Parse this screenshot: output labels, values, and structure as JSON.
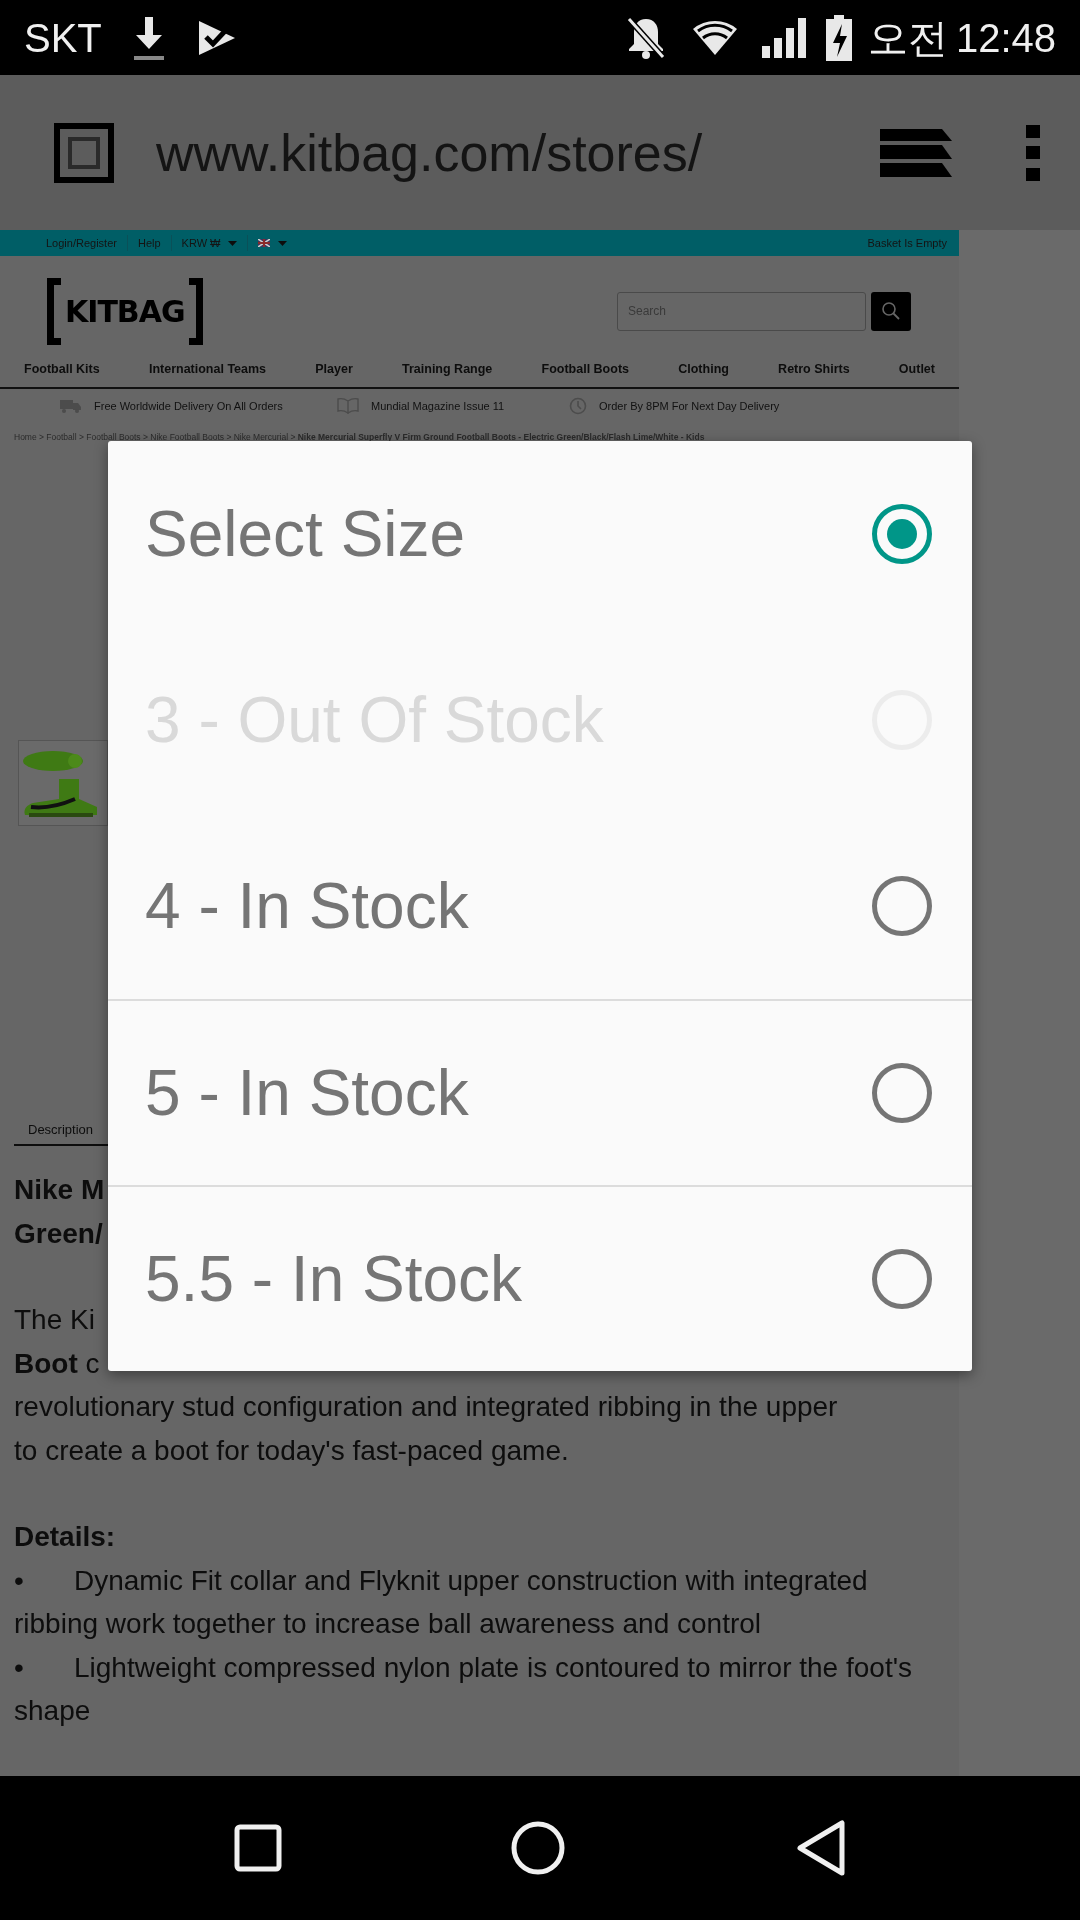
{
  "status_bar": {
    "carrier": "SKT",
    "time_period": "오전",
    "time": "12:48"
  },
  "browser": {
    "url": "www.kitbag.com/stores/"
  },
  "site": {
    "top_bar": {
      "links": [
        {
          "label": "Login/Register",
          "kind": "link"
        },
        {
          "label": "Help",
          "kind": "link"
        },
        {
          "label": "KRW ₩",
          "kind": "dropdown"
        },
        {
          "kind": "flag"
        }
      ],
      "basket": "Basket Is Empty"
    },
    "logo": "KITBAG",
    "search": {
      "placeholder": "Search"
    },
    "nav": [
      "Football Kits",
      "International Teams",
      "Player",
      "Training Range",
      "Football Boots",
      "Clothing",
      "Retro Shirts",
      "Outlet"
    ],
    "info": [
      {
        "text": "Free Worldwide Delivery On All Orders",
        "kind": "truck"
      },
      {
        "text": "Mundial Magazine Issue 11",
        "kind": "book"
      },
      {
        "text": "Order By 8PM For Next Day Delivery",
        "kind": "clock"
      }
    ],
    "breadcrumb": "Home > Football > Football Boots > Nike Football Boots > Nike Mercurial > **Nike Mercurial Superfly V Firm Ground Football Boots - Electric Green/Black/Flash Lime/White - Kids**",
    "tabs": [
      {
        "label": "Description",
        "selected": true
      }
    ],
    "description": {
      "title_lines": [
        "Nike M",
        "Green/"
      ],
      "paragraph_lines": [
        "The Ki",
        "**Boot** c",
        "revolutionary stud configuration and integrated ribbing in the upper",
        "to create a boot for today's fast-paced game."
      ],
      "details_heading": "Details:",
      "bullets": [
        "•\tDynamic Fit collar and Flyknit upper construction with integrated ribbing work together to increase ball awareness and control",
        "•\tLightweight compressed nylon plate is contoured to mirror the foot's shape"
      ]
    }
  },
  "dialog": {
    "options": [
      {
        "label": "Select Size",
        "selected": true,
        "disabled": false,
        "divider_above": false
      },
      {
        "label": "3 - Out Of Stock",
        "selected": false,
        "disabled": true,
        "divider_above": false
      },
      {
        "label": "4 - In Stock",
        "selected": false,
        "disabled": false,
        "divider_above": false
      },
      {
        "label": "5 - In Stock",
        "selected": false,
        "disabled": false,
        "divider_above": true
      },
      {
        "label": "5.5 - In Stock",
        "selected": false,
        "disabled": false,
        "divider_above": true
      }
    ]
  }
}
